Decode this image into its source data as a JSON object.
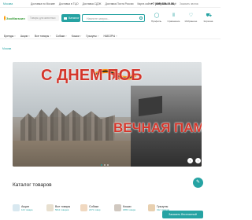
{
  "topbar": {
    "city": "Москва",
    "links": [
      "Доставка по Москве",
      "Доставка в ТЦО",
      "Доставка СДЭК",
      "Доставка Почта России",
      "Карта сайта",
      "Контакты",
      "Ещё"
    ],
    "phone": "+7 (495) 729-09-50",
    "callback": "Заказать звонок"
  },
  "header": {
    "logo_text": "ЗооМагазин",
    "search_placeholder_small": "Товары для животных",
    "catalog_label": "Каталог",
    "search_placeholder": "Начните запрос...",
    "icons": [
      {
        "name": "profile-icon",
        "label": "Профиль"
      },
      {
        "name": "compare-icon",
        "label": "Сравнение"
      },
      {
        "name": "heart-icon",
        "label": "Избранное"
      },
      {
        "name": "cart-icon",
        "label": "Корзина"
      }
    ]
  },
  "menubar": {
    "items": [
      "Бренды",
      "Акции",
      "Все товары",
      "Собаки",
      "Кошки",
      "Грызуны",
      "НАБОРЫ"
    ]
  },
  "breadcrumb": "Москва",
  "banner": {
    "title_top": "С ДНЕМ ПОБ",
    "title_bottom": "ВЕЧНАЯ ПАМЯТЬ",
    "prev_label": "‹",
    "next_label": "›"
  },
  "catalog": {
    "title": "Каталог товаров",
    "categories": [
      {
        "name": "Акции",
        "count": "124 товара",
        "color": "#d8e8f0"
      },
      {
        "name": "Все товары",
        "count": "5612 товаров",
        "color": "#e8e0d0"
      },
      {
        "name": "Собаки",
        "count": "2471 товар",
        "color": "#f0d8c0"
      },
      {
        "name": "Кошки",
        "count": "1883 товара",
        "color": "#d0c8c0"
      },
      {
        "name": "Грызуны",
        "count": "312 товаров",
        "color": "#e8d0b0"
      },
      {
        "name": "НАБОРЫ",
        "count": "48 товаров",
        "color": "#c8e0c8"
      }
    ],
    "order_button": "Заказать бесплатный"
  },
  "colors": {
    "accent": "#26a3a3",
    "banner_title": "#d4362b"
  }
}
